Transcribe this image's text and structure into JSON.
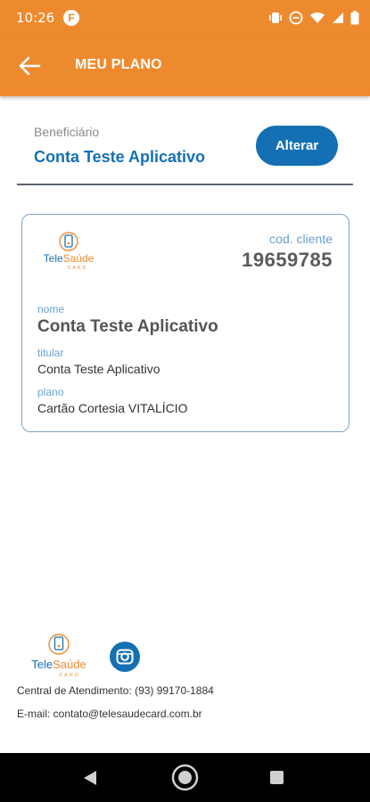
{
  "status_bar": {
    "time": "10:26",
    "left_icon": "F",
    "icons": [
      "vibrate-icon",
      "do-not-disturb-icon",
      "wifi-icon",
      "signal-icon",
      "battery-icon"
    ]
  },
  "app_bar": {
    "title": "MEU PLANO",
    "back_icon": "arrow-left-icon"
  },
  "beneficiary": {
    "label": "Beneficiário",
    "name": "Conta Teste Aplicativo",
    "change_button": "Alterar"
  },
  "card": {
    "logo_text": "TeleSaúde",
    "logo_sub": "CARD",
    "client_code_label": "cod. cliente",
    "client_code": "19659785",
    "fields": {
      "nome_label": "nome",
      "nome_value": "Conta Teste Aplicativo",
      "titular_label": "titular",
      "titular_value": "Conta Teste Aplicativo",
      "plano_label": "plano",
      "plano_value": "Cartão Cortesia VITALÍCIO"
    }
  },
  "footer": {
    "logo_text": "TeleSaúde",
    "logo_sub": "CARD",
    "social_icon": "instagram-icon",
    "contact_line": "Central de Atendimento: (93) 99170-1884",
    "email_line": "E-mail: contato@telesaudecard.com.br"
  },
  "colors": {
    "primary_orange": "#ee8a2e",
    "primary_blue": "#1570b3"
  },
  "nav_bar": {
    "icons": [
      "back-triangle-icon",
      "home-circle-icon",
      "recents-square-icon"
    ]
  }
}
